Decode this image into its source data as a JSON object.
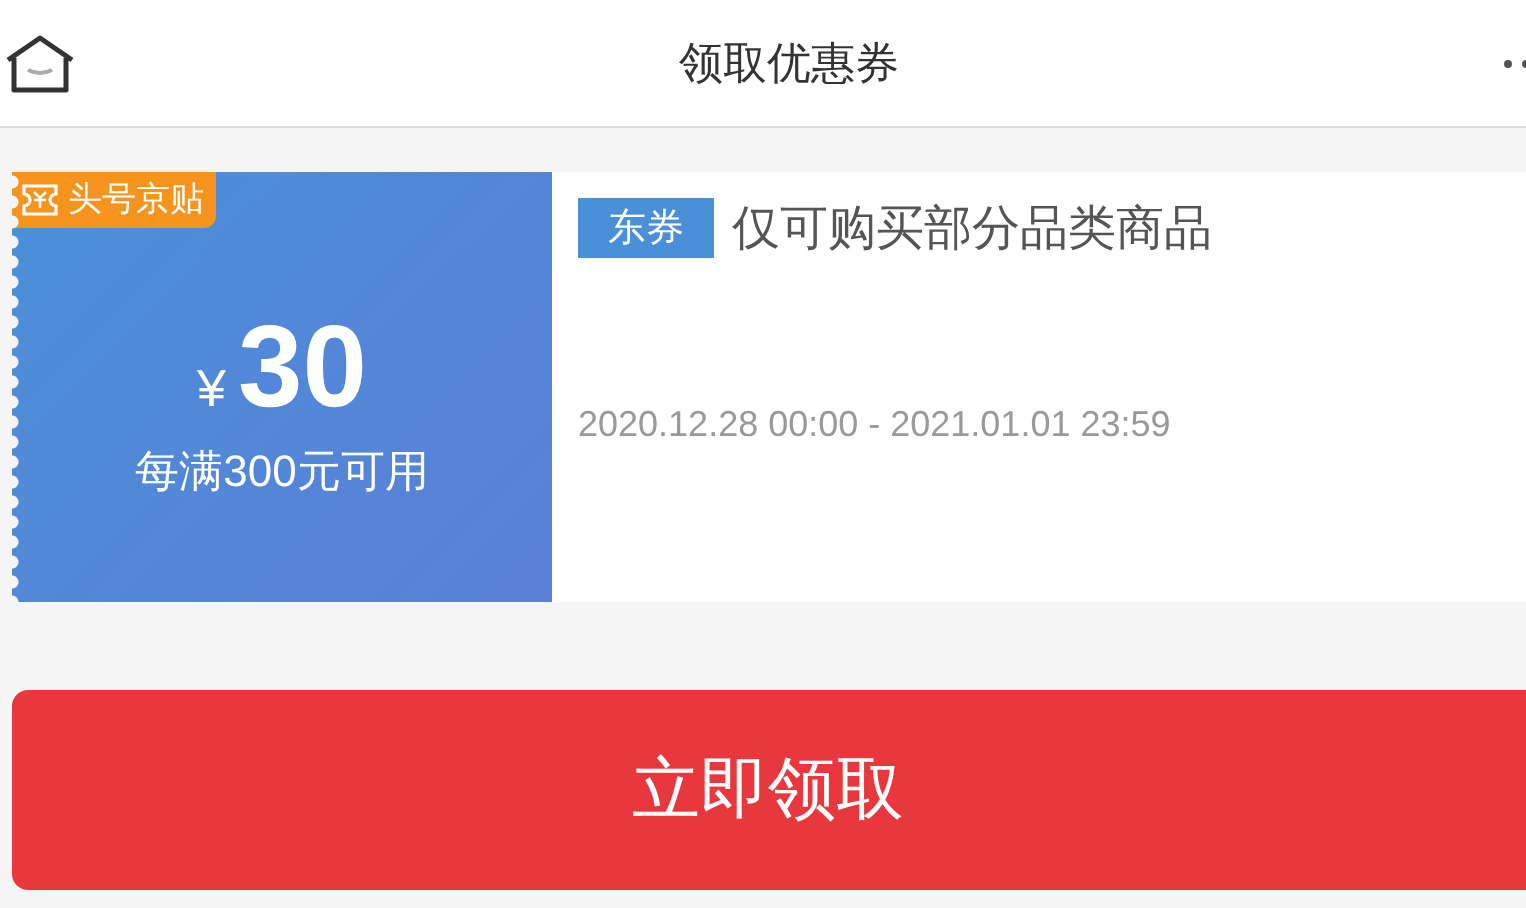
{
  "header": {
    "title": "领取优惠券"
  },
  "coupon": {
    "badge": "头号京贴",
    "currency": "¥",
    "amount": "30",
    "condition": "每满300元可用",
    "tag": "东券",
    "scope": "仅可购买部分品类商品",
    "validity": "2020.12.28 00:00 - 2021.01.01 23:59"
  },
  "action": {
    "label": "立即领取"
  }
}
